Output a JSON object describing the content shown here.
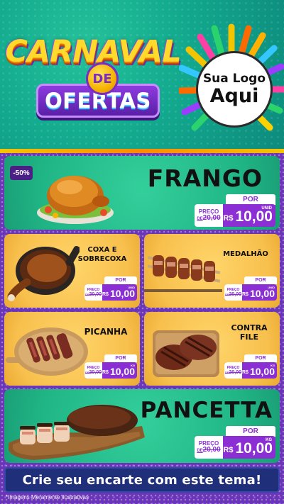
{
  "header": {
    "title_line1": "CARNAVAL",
    "title_connector": "DE",
    "title_line2": "OFERTAS",
    "logo_line1": "Sua Logo",
    "logo_line2": "Aqui"
  },
  "products": [
    {
      "name": "FRANGO",
      "badge": "-50%",
      "por_label": "POR",
      "preco_label": "PREÇO",
      "de_label": "DE",
      "old_price": "20,00",
      "currency": "R$",
      "price": "10,00",
      "unit": "UNID"
    },
    {
      "name": "COXA E SOBRECOXA",
      "name_line1": "COXA E",
      "name_line2": "SOBRECOXA",
      "por_label": "POR",
      "preco_label": "PREÇO",
      "de_label": "DE",
      "old_price": "20,00",
      "currency": "R$",
      "price": "10,00",
      "unit": "UNID"
    },
    {
      "name": "MEDALHÃO",
      "por_label": "POR",
      "preco_label": "PREÇO",
      "de_label": "DE",
      "old_price": "20,00",
      "currency": "R$",
      "price": "10,00",
      "unit": "UNID"
    },
    {
      "name": "PICANHA",
      "por_label": "POR",
      "preco_label": "PREÇO",
      "de_label": "DE",
      "old_price": "20,00",
      "currency": "R$",
      "price": "10,00",
      "unit": "KG"
    },
    {
      "name_line1": "CONTRA",
      "name_line2": "FILE",
      "por_label": "POR",
      "preco_label": "PREÇO",
      "de_label": "DE",
      "old_price": "20,00",
      "currency": "R$",
      "price": "10,00",
      "unit": "KG"
    },
    {
      "name": "PANCETTA",
      "por_label": "POR",
      "preco_label": "PREÇO",
      "de_label": "DE",
      "old_price": "20,00",
      "currency": "R$",
      "price": "10,00",
      "unit": "KG"
    }
  ],
  "footer": {
    "cta": "Crie seu encarte com este tema!",
    "disclaimer": "*Imagens Meramente Ilustrativas"
  },
  "colors": {
    "green_card": "#20b585",
    "yellow_card": "#f8c04d",
    "price_purple": "#8b2fd4",
    "cta_navy": "#1f2f7a"
  },
  "icons": [
    "whole-roast-chicken-image",
    "chicken-leg-pan-image",
    "bacon-medallion-skewers-image",
    "sliced-picanha-board-image",
    "grilled-steaks-board-image",
    "pancetta-roast-board-image"
  ]
}
